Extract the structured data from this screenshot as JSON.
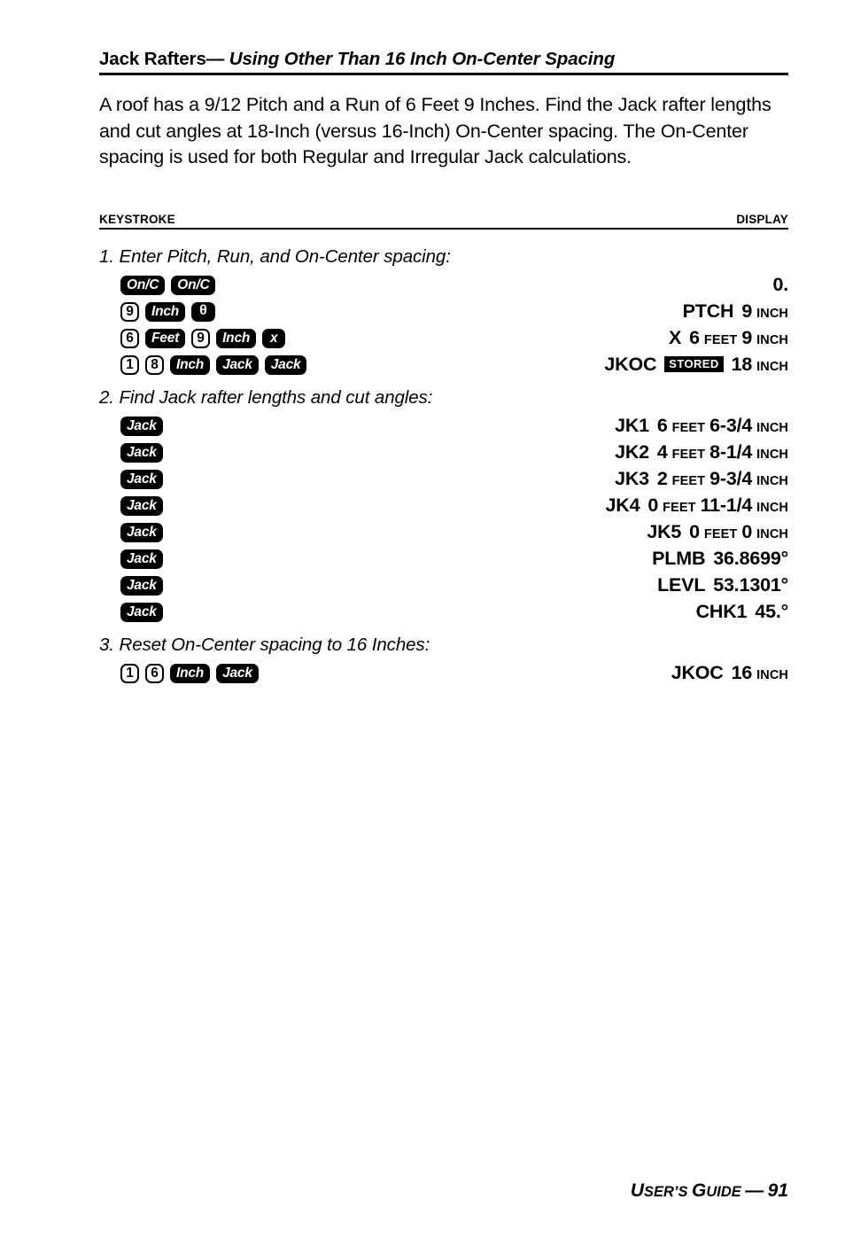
{
  "title": {
    "main": "Jack Rafters",
    "separator": "—",
    "subtitle": "Using Other Than 16 Inch On-Center Spacing"
  },
  "intro": "A roof has a 9/12 Pitch and a Run of 6 Feet 9 Inches. Find the Jack rafter lengths and cut angles at 18-Inch (versus 16-Inch) On-Center spacing. The On-Center spacing is used for both Regular and Irregular Jack calculations.",
  "columns": {
    "keystroke": "KEYSTROKE",
    "display": "DISPLAY"
  },
  "steps": [
    {
      "heading": "1. Enter Pitch, Run, and On-Center spacing:",
      "rows": [
        {
          "keys": [
            {
              "label": "On/C",
              "style": "dark"
            },
            {
              "label": "On/C",
              "style": "dark"
            }
          ],
          "display": {
            "value": "0."
          }
        },
        {
          "keys": [
            {
              "label": "9",
              "style": "num"
            },
            {
              "label": "Inch",
              "style": "dark"
            },
            {
              "label": "θ",
              "style": "theta"
            }
          ],
          "display": {
            "label": "PTCH",
            "value": "9",
            "unit": "INCH"
          }
        },
        {
          "keys": [
            {
              "label": "6",
              "style": "num"
            },
            {
              "label": "Feet",
              "style": "dark"
            },
            {
              "label": "9",
              "style": "num"
            },
            {
              "label": "Inch",
              "style": "dark"
            },
            {
              "label": "x",
              "style": "dark-sq"
            }
          ],
          "display": {
            "label": "X",
            "feet": "6",
            "feet_unit": "FEET",
            "value": "9",
            "unit": "INCH"
          }
        },
        {
          "keys": [
            {
              "label": "1",
              "style": "num"
            },
            {
              "label": "8",
              "style": "num"
            },
            {
              "label": "Inch",
              "style": "dark"
            },
            {
              "label": "Jack",
              "style": "dark"
            },
            {
              "label": "Jack",
              "style": "dark"
            }
          ],
          "display": {
            "label": "JKOC",
            "badge": "STORED",
            "value": "18",
            "unit": "INCH"
          }
        }
      ]
    },
    {
      "heading": "2. Find Jack rafter lengths and cut angles:",
      "rows": [
        {
          "keys": [
            {
              "label": "Jack",
              "style": "dark"
            }
          ],
          "display": {
            "label": "JK1",
            "feet": "6",
            "feet_unit": "FEET",
            "value": "6-3/4",
            "unit": "INCH"
          }
        },
        {
          "keys": [
            {
              "label": "Jack",
              "style": "dark"
            }
          ],
          "display": {
            "label": "JK2",
            "feet": "4",
            "feet_unit": "FEET",
            "value": "8-1/4",
            "unit": "INCH"
          }
        },
        {
          "keys": [
            {
              "label": "Jack",
              "style": "dark"
            }
          ],
          "display": {
            "label": "JK3",
            "feet": "2",
            "feet_unit": "FEET",
            "value": "9-3/4",
            "unit": "INCH"
          }
        },
        {
          "keys": [
            {
              "label": "Jack",
              "style": "dark"
            }
          ],
          "display": {
            "label": "JK4",
            "feet": "0",
            "feet_unit": "FEET",
            "value": "11-1/4",
            "unit": "INCH"
          }
        },
        {
          "keys": [
            {
              "label": "Jack",
              "style": "dark"
            }
          ],
          "display": {
            "label": "JK5",
            "feet": "0",
            "feet_unit": "FEET",
            "value": "0",
            "unit": "INCH"
          }
        },
        {
          "keys": [
            {
              "label": "Jack",
              "style": "dark"
            }
          ],
          "display": {
            "label": "PLMB",
            "value": "36.8699°"
          }
        },
        {
          "keys": [
            {
              "label": "Jack",
              "style": "dark"
            }
          ],
          "display": {
            "label": "LEVL",
            "value": "53.1301°"
          }
        },
        {
          "keys": [
            {
              "label": "Jack",
              "style": "dark"
            }
          ],
          "display": {
            "label": "CHK1",
            "value": "45.°"
          }
        }
      ]
    },
    {
      "heading": "3. Reset On-Center spacing to 16 Inches:",
      "rows": [
        {
          "keys": [
            {
              "label": "1",
              "style": "num"
            },
            {
              "label": "6",
              "style": "num"
            },
            {
              "label": "Inch",
              "style": "dark"
            },
            {
              "label": "Jack",
              "style": "dark"
            }
          ],
          "display": {
            "label": "JKOC",
            "value": "16",
            "unit": "INCH"
          }
        }
      ]
    }
  ],
  "footer": {
    "word1_cap": "U",
    "word1_rest": "SER’S",
    "word2_cap": "G",
    "word2_rest": "UIDE",
    "dash": "—",
    "page": "91"
  }
}
